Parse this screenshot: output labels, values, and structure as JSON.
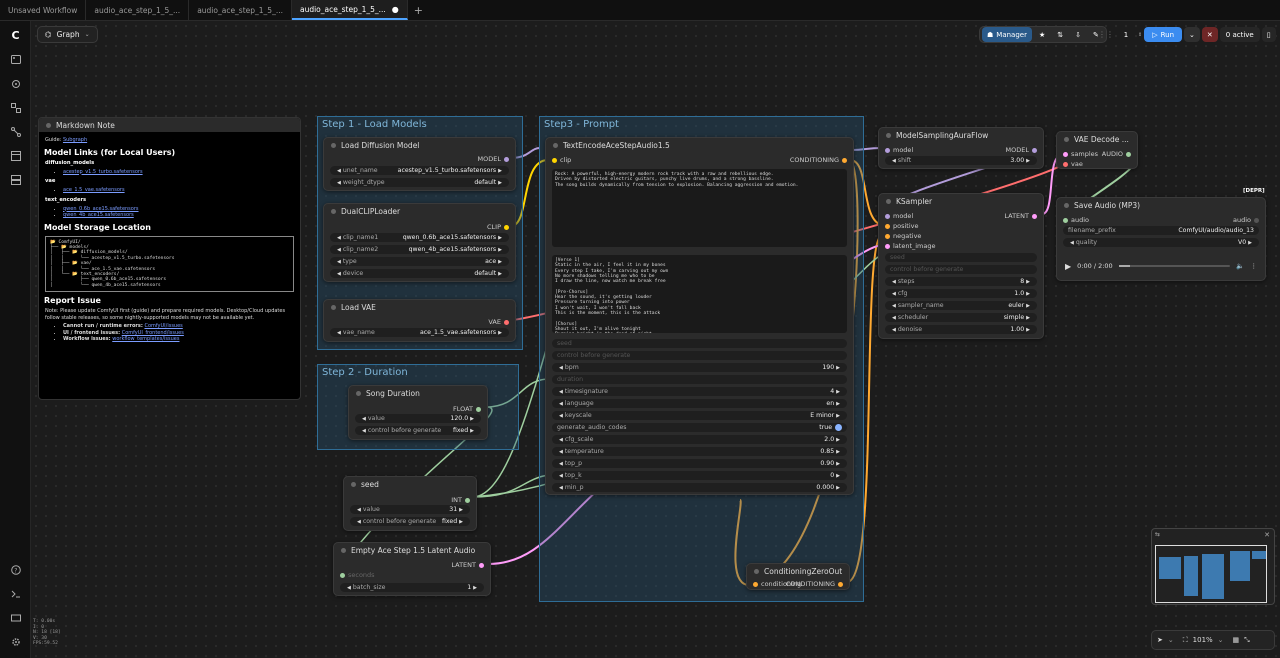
{
  "tabs": [
    {
      "label": "Unsaved Workflow",
      "active": false
    },
    {
      "label": "audio_ace_step_1_5_...",
      "active": false
    },
    {
      "label": "audio_ace_step_1_5_...",
      "active": false
    },
    {
      "label": "audio_ace_step_1_5_...",
      "active": true,
      "modified": "●"
    }
  ],
  "tab_add": "+",
  "graph_button": "Graph",
  "topbar": {
    "manager": "Manager",
    "queue_count": "1",
    "run": "Run",
    "active": "0 active"
  },
  "groups": {
    "step1": "Step 1 - Load Models",
    "step2": "Step 2 - Duration",
    "step3": "Step3 - Prompt"
  },
  "note": {
    "title": "Markdown Note",
    "guide_label": "Guide:",
    "guide_link": "Subgraph",
    "h_model_links": "Model Links (for Local Users)",
    "diffusion_models": "diffusion_models",
    "diffusion_file": "acestep_v1.5_turbo.safetensors",
    "vae": "vae",
    "vae_file": "ace_1.5_vae.safetensors",
    "text_encoders": "text_encoders",
    "te_file1": "qwen_0.6b_ace15.safetensors",
    "te_file2": "qwen_4b_ace15.safetensors",
    "h_storage": "Model Storage Location",
    "tree": "📂 ComfyUI/\n├── 📂 models/\n│   ├── 📂 diffusion_models/\n│   │      └── acestep_v1.5_turbo.safetensors\n│   ├── 📂 vae/\n│   │      └── ace_1.5_vae.safetensors\n│   └── 📂 text_encoders/\n│          ├── qwen_0.6b_ace15.safetensors\n│          └── qwen_4b_ace15.safetensors",
    "h_report": "Report Issue",
    "report_text": "Note: Please update ComfyUI first (guide) and prepare required models. Desktop/Cloud updates follow stable releases, so some nightly-supported models may not be available yet.",
    "li1_label": "Cannot run / runtime errors:",
    "li1_link": "ComfyUI/issues",
    "li2_label": "UI / frontend issues:",
    "li2_link": "ComfyUI_frontend/issues",
    "li3_label": "Workflow issues:",
    "li3_link": "workflow_templates/issues"
  },
  "load_diffusion": {
    "title": "Load Diffusion Model",
    "output": "MODEL",
    "unet_name_label": "unet_name",
    "unet_name": "acestep_v1.5_turbo.safetensors",
    "weight_dtype_label": "weight_dtype",
    "weight_dtype": "default"
  },
  "dual_clip": {
    "title": "DualCLIPLoader",
    "output": "CLIP",
    "clip1_label": "clip_name1",
    "clip1": "qwen_0.6b_ace15.safetensors",
    "clip2_label": "clip_name2",
    "clip2": "qwen_4b_ace15.safetensors",
    "type_label": "type",
    "type": "ace",
    "device_label": "device",
    "device": "default"
  },
  "load_vae": {
    "title": "Load VAE",
    "output": "VAE",
    "vae_name_label": "vae_name",
    "vae_name": "ace_1.5_vae.safetensors"
  },
  "song_duration": {
    "title": "Song Duration",
    "output": "FLOAT",
    "value_label": "value",
    "value": "120.0",
    "control_label": "control before generate",
    "control": "fixed"
  },
  "seed_node": {
    "title": "seed",
    "output": "INT",
    "value_label": "value",
    "value": "31",
    "control_label": "control before generate",
    "control": "fixed"
  },
  "empty_latent": {
    "title": "Empty Ace Step 1.5 Latent Audio",
    "output": "LATENT",
    "seconds_label": "seconds",
    "batch_label": "batch_size",
    "batch": "1"
  },
  "text_encode": {
    "title": "TextEncodeAceStepAudio1.5",
    "input_clip": "clip",
    "output": "CONDITIONING",
    "tags": "Rock: A powerful, high-energy modern rock track with a raw and rebellious edge.\nDriven by distorted electric guitars, punchy live drums, and a strong bassline.\nThe song builds dynamically from tension to explosion. Balancing aggression and emotion.",
    "lyrics": "[Verse 1]\nStatic in the air, I feel it in my bones\nEvery step I take, I'm carving out my own\nNo more shadows telling me who to be\nI draw the line, now watch me break free\n\n[Pre-Chorus]\nHear the sound, it's getting louder\nPressure turning into power\nI won't wait, I won't fall back\nThis is the moment, this is the attack\n\n[Chorus]\nShout it out, I'm alive tonight\nBurning bright in the dead of night",
    "seed_label": "seed",
    "control_label": "control before generate",
    "bpm_label": "bpm",
    "bpm": "190",
    "duration_label": "duration",
    "timesig_label": "timesignature",
    "timesig": "4",
    "language_label": "language",
    "language": "en",
    "keyscale_label": "keyscale",
    "keyscale": "E minor",
    "gac_label": "generate_audio_codes",
    "gac": "true",
    "cfg_label": "cfg_scale",
    "cfg": "2.0",
    "temp_label": "temperature",
    "temp": "0.85",
    "topp_label": "top_p",
    "topp": "0.90",
    "topk_label": "top_k",
    "topk": "0",
    "minp_label": "min_p",
    "minp": "0.000"
  },
  "cond_zero": {
    "title": "ConditioningZeroOut",
    "input": "conditioning",
    "output": "CONDITIONING"
  },
  "model_sampling": {
    "title": "ModelSamplingAuraFlow",
    "input": "model",
    "output": "MODEL",
    "shift_label": "shift",
    "shift": "3.00"
  },
  "ksampler": {
    "title": "KSampler",
    "output": "LATENT",
    "in_model": "model",
    "in_positive": "positive",
    "in_negative": "negative",
    "in_latent": "latent_image",
    "seed_label": "seed",
    "control_label": "control before generate",
    "steps_label": "steps",
    "steps": "8",
    "cfg_label": "cfg",
    "cfg": "1.0",
    "sampler_label": "sampler_name",
    "sampler": "euler",
    "scheduler_label": "scheduler",
    "scheduler": "simple",
    "denoise_label": "denoise",
    "denoise": "1.00"
  },
  "vae_decode": {
    "title": "VAE Decode ...",
    "in_samples": "samples",
    "in_vae": "vae",
    "output": "AUDIO"
  },
  "save_audio": {
    "badge": "[DEPR]",
    "title": "Save Audio (MP3)",
    "input": "audio",
    "input_right": "audio",
    "prefix_label": "filename_prefix",
    "prefix": "ComfyUI/audio/audio_13",
    "quality_label": "quality",
    "quality": "V0",
    "time": "0:00 / 2:00"
  },
  "bottom": {
    "zoom": "101%"
  },
  "stats": "T: 0.00s\nI: 0\nN: 18 [18]\nV: 30\nFPS:59.52",
  "colors": {
    "accent": "#4da3ff",
    "group": "#2f6d96",
    "run": "#3b8cf0",
    "wire_model": "#b39ddb",
    "wire_clip": "#ffd500",
    "wire_cond": "#ffa931",
    "wire_vae": "#ff6e6e",
    "wire_latent": "#ff9cf9",
    "wire_int": "#9fcf9f"
  }
}
